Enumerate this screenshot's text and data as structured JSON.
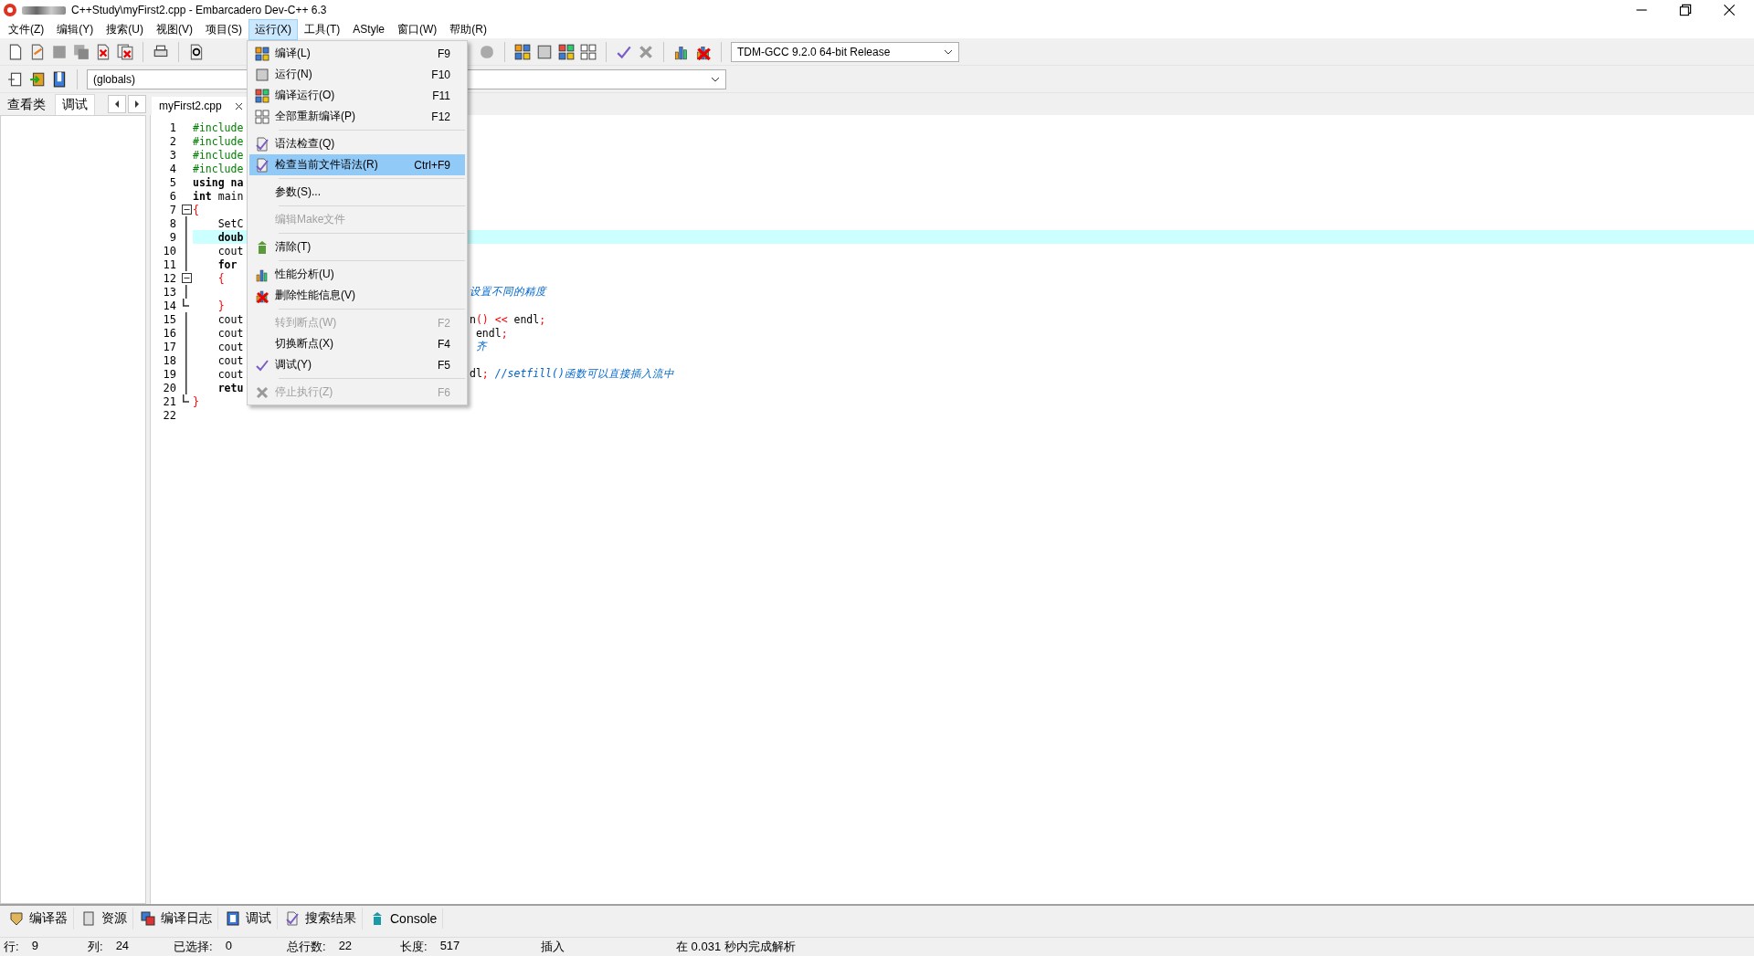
{
  "window": {
    "title": "C++Study\\myFirst2.cpp - Embarcadero Dev-C++ 6.3"
  },
  "menu_bar": [
    {
      "label": "文件(Z)",
      "selected": false
    },
    {
      "label": "编辑(Y)",
      "selected": false
    },
    {
      "label": "搜索(U)",
      "selected": false
    },
    {
      "label": "视图(V)",
      "selected": false
    },
    {
      "label": "项目(S)",
      "selected": false
    },
    {
      "label": "运行(X)",
      "selected": true
    },
    {
      "label": "工具(T)",
      "selected": false
    },
    {
      "label": "AStyle",
      "selected": false
    },
    {
      "label": "窗口(W)",
      "selected": false
    },
    {
      "label": "帮助(R)",
      "selected": false
    }
  ],
  "run_menu": [
    {
      "kind": "command",
      "label": "编译(L)",
      "shortcut": "F9",
      "disabled": false,
      "selected": false
    },
    {
      "kind": "command",
      "label": "运行(N)",
      "shortcut": "F10",
      "disabled": false,
      "selected": false
    },
    {
      "kind": "command",
      "label": "编译运行(O)",
      "shortcut": "F11",
      "disabled": false,
      "selected": false
    },
    {
      "kind": "command",
      "label": "全部重新编译(P)",
      "shortcut": "F12",
      "disabled": false,
      "selected": false
    },
    {
      "kind": "separator"
    },
    {
      "kind": "command",
      "label": "语法检查(Q)",
      "disabled": false,
      "selected": false
    },
    {
      "kind": "command",
      "label": "检查当前文件语法(R)",
      "shortcut": "Ctrl+F9",
      "disabled": false,
      "selected": true
    },
    {
      "kind": "separator"
    },
    {
      "kind": "command",
      "label": "参数(S)...",
      "disabled": false,
      "selected": false
    },
    {
      "kind": "separator"
    },
    {
      "kind": "command",
      "label": "编辑Make文件",
      "disabled": true,
      "selected": false
    },
    {
      "kind": "separator"
    },
    {
      "kind": "command",
      "label": "清除(T)",
      "disabled": false,
      "selected": false
    },
    {
      "kind": "separator"
    },
    {
      "kind": "command",
      "label": "性能分析(U)",
      "disabled": false,
      "selected": false
    },
    {
      "kind": "command",
      "label": "删除性能信息(V)",
      "disabled": false,
      "selected": false
    },
    {
      "kind": "separator"
    },
    {
      "kind": "command",
      "label": "转到断点(W)",
      "shortcut": "F2",
      "disabled": true,
      "selected": false
    },
    {
      "kind": "command",
      "label": "切换断点(X)",
      "shortcut": "F4",
      "disabled": false,
      "selected": false
    },
    {
      "kind": "command",
      "label": "调试(Y)",
      "shortcut": "F5",
      "disabled": false,
      "selected": false
    },
    {
      "kind": "separator"
    },
    {
      "kind": "command",
      "label": "停止执行(Z)",
      "shortcut": "F6",
      "disabled": true,
      "selected": false
    }
  ],
  "compiler_select": {
    "value": "TDM-GCC 9.2.0 64-bit Release"
  },
  "scope_select": {
    "value": "(globals)"
  },
  "left_tabs": [
    {
      "label": "查看类",
      "selected": false
    },
    {
      "label": "调试",
      "selected": true
    }
  ],
  "file_tabs": [
    {
      "label": "myFirst2.cpp",
      "selected": true
    }
  ],
  "editor": {
    "lines": [
      {
        "number": "1",
        "current": false,
        "kind": "plain",
        "head": [
          {
            "kind": "pre",
            "text": "#include"
          }
        ]
      },
      {
        "number": "2",
        "current": false,
        "kind": "plain",
        "head": [
          {
            "kind": "pre",
            "text": "#include"
          }
        ]
      },
      {
        "number": "3",
        "current": false,
        "kind": "plain",
        "head": [
          {
            "kind": "pre",
            "text": "#include"
          }
        ]
      },
      {
        "number": "4",
        "current": false,
        "kind": "plain",
        "head": [
          {
            "kind": "pre",
            "text": "#include"
          }
        ]
      },
      {
        "number": "5",
        "current": false,
        "kind": "plain",
        "head": [
          {
            "kind": "kw",
            "text": "using na"
          }
        ]
      },
      {
        "number": "6",
        "current": false,
        "kind": "plain",
        "head": [
          {
            "kind": "kw",
            "text": "int"
          },
          {
            "kind": "plain",
            "text": " main"
          }
        ]
      },
      {
        "number": "7",
        "current": false,
        "kind": "fold-start",
        "head": [
          {
            "kind": "sym",
            "text": "{"
          }
        ]
      },
      {
        "number": "8",
        "current": false,
        "kind": "fold-body",
        "head": [
          {
            "kind": "plain",
            "text": "    SetC"
          }
        ]
      },
      {
        "number": "9",
        "current": true,
        "kind": "fold-body",
        "head": [
          {
            "kind": "kw",
            "text": "    doub"
          }
        ]
      },
      {
        "number": "10",
        "current": false,
        "kind": "fold-body",
        "head": [
          {
            "kind": "plain",
            "text": "    cout"
          }
        ]
      },
      {
        "number": "11",
        "current": false,
        "kind": "fold-body",
        "head": [
          {
            "kind": "kw",
            "text": "    for"
          }
        ]
      },
      {
        "number": "12",
        "current": false,
        "kind": "fold-start",
        "head": [
          {
            "kind": "sym",
            "text": "    {"
          }
        ]
      },
      {
        "number": "13",
        "current": false,
        "kind": "fold-body",
        "tail": [
          {
            "kind": "comment",
            "text": "设置不同的精度"
          }
        ]
      },
      {
        "number": "14",
        "current": false,
        "kind": "fold-end",
        "head": [
          {
            "kind": "sym",
            "text": "    }"
          }
        ]
      },
      {
        "number": "15",
        "current": false,
        "kind": "fold-body",
        "head": [
          {
            "kind": "plain",
            "text": "    cout"
          }
        ],
        "tail": [
          {
            "kind": "plain",
            "text": "n"
          },
          {
            "kind": "sym",
            "text": "() << "
          },
          {
            "kind": "plain",
            "text": "endl"
          },
          {
            "kind": "sym",
            "text": ";"
          }
        ]
      },
      {
        "number": "16",
        "current": false,
        "kind": "fold-body",
        "head": [
          {
            "kind": "plain",
            "text": "    cout"
          }
        ],
        "tail": [
          {
            "kind": "plain",
            "text": " endl"
          },
          {
            "kind": "sym",
            "text": ";"
          }
        ]
      },
      {
        "number": "17",
        "current": false,
        "kind": "fold-body",
        "head": [
          {
            "kind": "plain",
            "text": "    cout"
          }
        ],
        "tail": [
          {
            "kind": "comment",
            "text": " 齐"
          }
        ]
      },
      {
        "number": "18",
        "current": false,
        "kind": "fold-body",
        "head": [
          {
            "kind": "plain",
            "text": "    cout"
          }
        ]
      },
      {
        "number": "19",
        "current": false,
        "kind": "fold-body",
        "head": [
          {
            "kind": "plain",
            "text": "    cout"
          }
        ],
        "tail": [
          {
            "kind": "plain",
            "text": "dl"
          },
          {
            "kind": "sym",
            "text": ";"
          },
          {
            "kind": "comment",
            "text": " //setfill()函数可以直接插入流中"
          }
        ]
      },
      {
        "number": "20",
        "current": false,
        "kind": "fold-body",
        "head": [
          {
            "kind": "kw",
            "text": "    retu"
          }
        ]
      },
      {
        "number": "21",
        "current": false,
        "kind": "fold-end",
        "head": [
          {
            "kind": "sym",
            "text": "}"
          }
        ]
      },
      {
        "number": "22",
        "current": false,
        "kind": "plain"
      }
    ]
  },
  "bottom_tabs": [
    {
      "label": "编译器"
    },
    {
      "label": "资源"
    },
    {
      "label": "编译日志"
    },
    {
      "label": "调试"
    },
    {
      "label": "搜索结果"
    },
    {
      "label": "Console"
    }
  ],
  "status_bar": {
    "fields": [
      {
        "label": "行:",
        "value": "9"
      },
      {
        "label": "列:",
        "value": "24"
      },
      {
        "label": "已选择:",
        "value": "0"
      },
      {
        "label": "总行数:",
        "value": "22"
      },
      {
        "label": "长度:",
        "value": "517"
      }
    ],
    "mode": "插入",
    "message": "在 0.031 秒内完成解析"
  }
}
